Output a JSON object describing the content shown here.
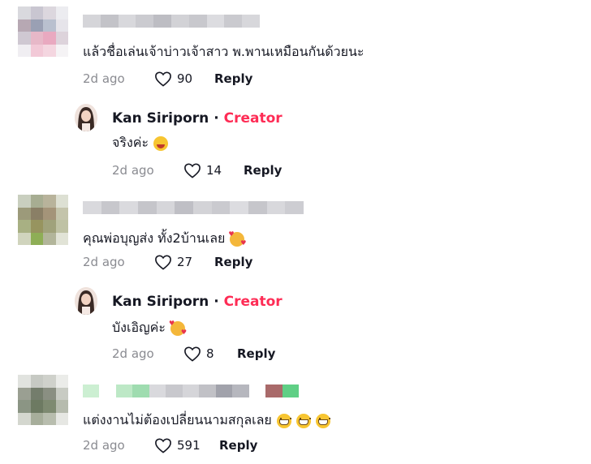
{
  "comments": [
    {
      "text": "แล้วชื่อเล่นเจ้าบ่าวเจ้าสาว พ.พานเหมือนกันด้วยนะ",
      "time": "2d ago",
      "likes": "90",
      "reply_label": "Reply",
      "reply": {
        "name": "Kan Siriporn",
        "dot": "·",
        "badge": "Creator",
        "text": "จริงค่ะ",
        "time": "2d ago",
        "likes": "14",
        "reply_label": "Reply"
      }
    },
    {
      "text": "คุณพ่อบุญส่ง ทั้ง2บ้านเลย",
      "time": "2d ago",
      "likes": "27",
      "reply_label": "Reply",
      "reply": {
        "name": "Kan Siriporn",
        "dot": "·",
        "badge": "Creator",
        "text": "บังเอิญค่ะ",
        "time": "2d ago",
        "likes": "8",
        "reply_label": "Reply"
      }
    },
    {
      "text": "แต่งงานไม่ต้องเปลี่ยนนามสกุลเลย",
      "time": "2d ago",
      "likes": "591",
      "reply_label": "Reply"
    }
  ],
  "colors": {
    "creator": "#fe2c55",
    "muted": "#8a8b91",
    "text": "#161823"
  },
  "icons": {
    "like": "heart-outline-icon",
    "emoji_grin": "grinning-emoji-icon",
    "emoji_love": "smiling-face-with-hearts-emoji-icon",
    "emoji_beaming": "beaming-face-emoji-icon"
  }
}
